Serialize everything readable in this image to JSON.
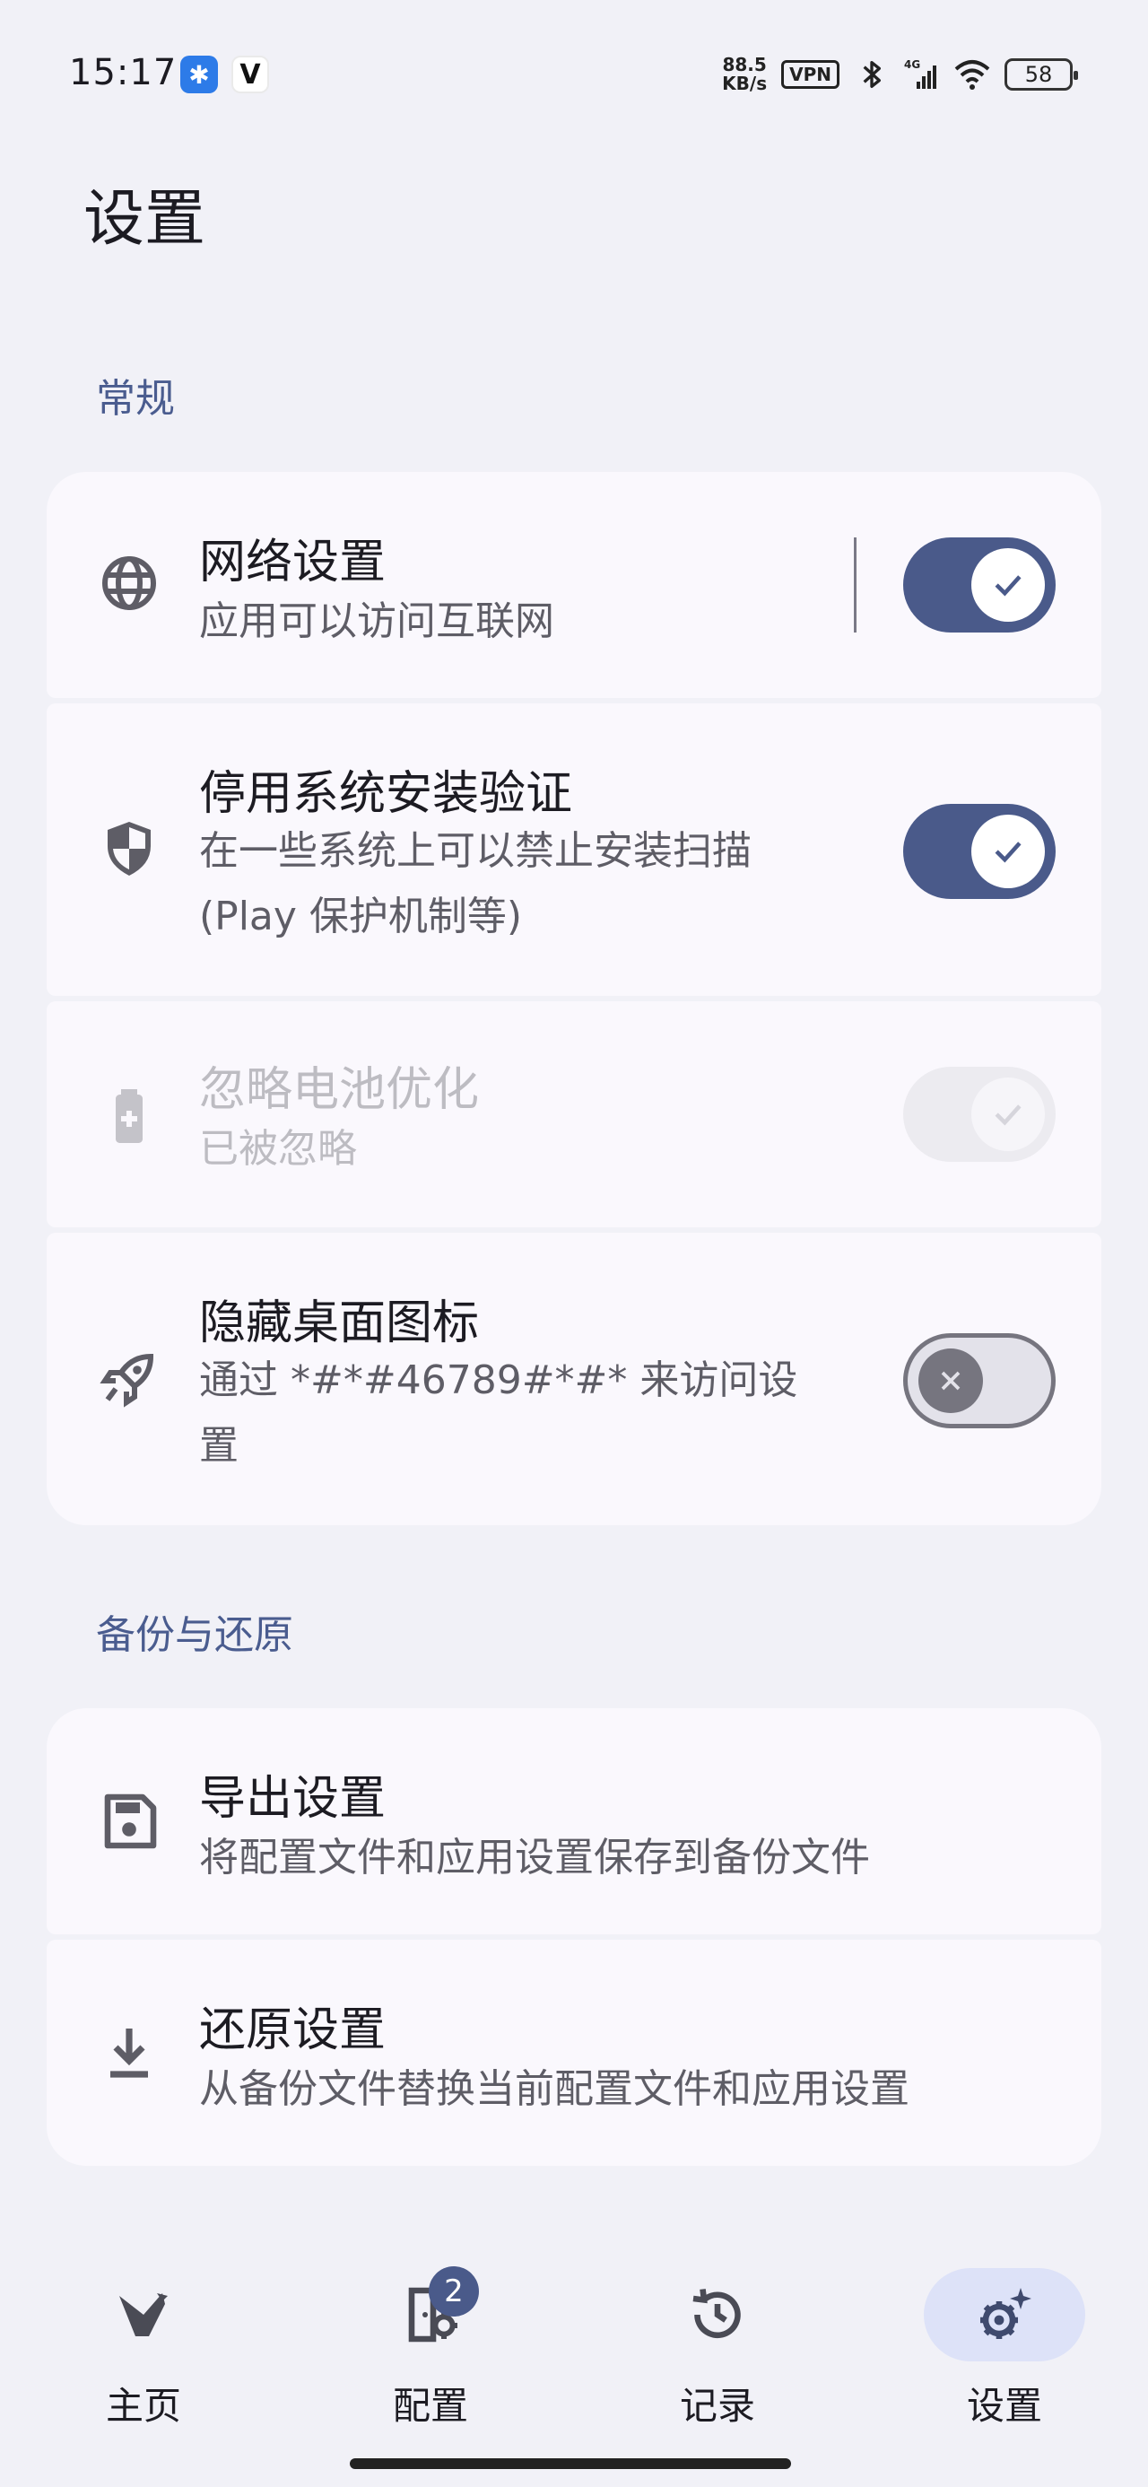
{
  "status_bar": {
    "time": "15:17",
    "app1_glyph": "✱",
    "app2_glyph": "V",
    "net_speed_value": "88.5",
    "net_speed_unit": "KB/s",
    "vpn": "VPN",
    "network_type": "4G",
    "battery": "58"
  },
  "page_title": "设置",
  "sections": {
    "general": {
      "header": "常规",
      "items": [
        {
          "title": "网络设置",
          "subtitle": "应用可以访问互联网",
          "icon": "globe-icon",
          "switch": "on"
        },
        {
          "title": "停用系统安装验证",
          "subtitle_line1": "在一些系统上可以禁止安装扫描",
          "subtitle_line2": "(Play 保护机制等)",
          "icon": "shield-icon",
          "switch": "on"
        },
        {
          "title": "忽略电池优化",
          "subtitle": "已被忽略",
          "icon": "battery-plus-icon",
          "switch": "on-disabled"
        },
        {
          "title": "隐藏桌面图标",
          "subtitle_line1": "通过 *#*#46789#*#* 来访问设",
          "subtitle_line2": "置",
          "icon": "rocket-icon",
          "switch": "off"
        }
      ]
    },
    "backup": {
      "header": "备份与还原",
      "items": [
        {
          "title": "导出设置",
          "subtitle": "将配置文件和应用设置保存到备份文件",
          "icon": "save-icon"
        },
        {
          "title": "还原设置",
          "subtitle": "从备份文件替换当前配置文件和应用设置",
          "icon": "download-icon"
        }
      ]
    }
  },
  "bottom_nav": {
    "items": [
      {
        "label": "主页",
        "icon": "home-bird-icon",
        "active": false
      },
      {
        "label": "配置",
        "icon": "profiles-icon",
        "active": false,
        "badge": "2"
      },
      {
        "label": "记录",
        "icon": "history-icon",
        "active": false
      },
      {
        "label": "设置",
        "icon": "settings-gear-icon",
        "active": true
      }
    ]
  },
  "colors": {
    "background": "#F1F1F7",
    "card": "#FAF8FD",
    "accent": "#4A5A8A",
    "section_header": "#4A5C8F",
    "nav_active_pill": "#DDE2F8"
  }
}
